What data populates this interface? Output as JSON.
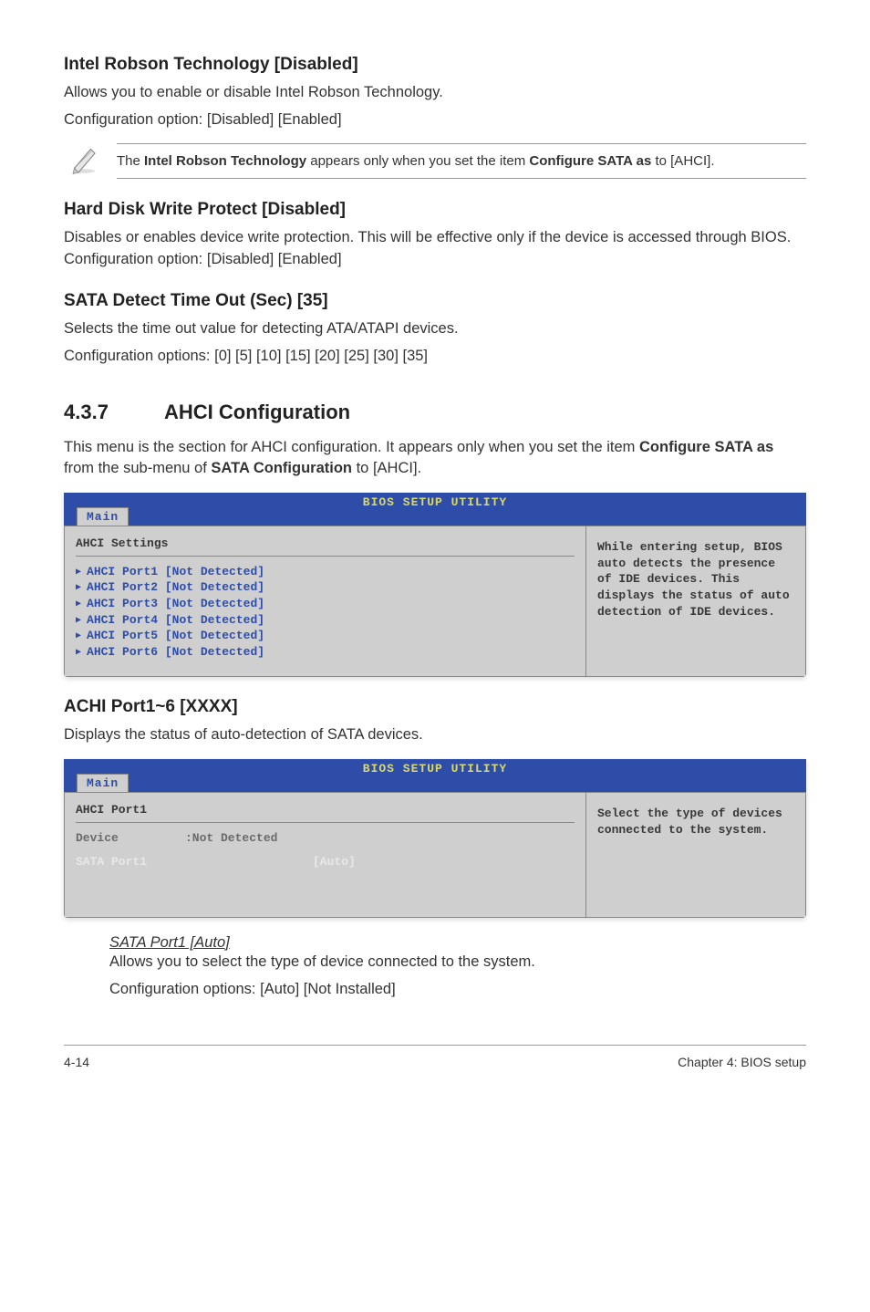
{
  "s1": {
    "heading": "Intel Robson Technology [Disabled]",
    "p1": "Allows you to enable or disable Intel Robson Technology.",
    "p2": "Configuration option: [Disabled] [Enabled]",
    "note_pre": "The ",
    "note_b1": "Intel Robson Technology",
    "note_mid": " appears only when you set the item ",
    "note_b2": "Configure SATA as",
    "note_post": " to [AHCI]."
  },
  "s2": {
    "heading": "Hard Disk Write Protect [Disabled]",
    "p1": "Disables or enables device write protection. This will be effective only if the device is accessed through BIOS. Configuration option: [Disabled] [Enabled]"
  },
  "s3": {
    "heading": "SATA Detect Time Out (Sec) [35]",
    "p1": "Selects the time out value for detecting ATA/ATAPI devices.",
    "p2": "Configuration options: [0] [5] [10] [15] [20] [25] [30] [35]"
  },
  "s4": {
    "num": "4.3.7",
    "title": "AHCI Configuration",
    "p1_pre": "This menu is the section for AHCI configuration. It appears only when you set the item ",
    "p1_b1": "Configure SATA as",
    "p1_mid": " from the sub-menu of ",
    "p1_b2": "SATA Configuration",
    "p1_post": " to [AHCI]."
  },
  "bios1": {
    "title": "BIOS SETUP UTILITY",
    "tab": "Main",
    "panel_title": "AHCI Settings",
    "rows": [
      "AHCI Port1 [Not Detected]",
      "AHCI Port2 [Not Detected]",
      "AHCI Port3 [Not Detected]",
      "AHCI Port4 [Not Detected]",
      "AHCI Port5 [Not Detected]",
      "AHCI Port6 [Not Detected]"
    ],
    "help": "While entering setup, BIOS auto detects the presence of IDE devices. This displays the status of auto detection of IDE devices."
  },
  "s5": {
    "heading": "ACHI Port1~6 [XXXX]",
    "p1": "Displays the status of auto-detection of SATA devices."
  },
  "bios2": {
    "title": "BIOS SETUP UTILITY",
    "tab": "Main",
    "panel_title": "AHCI Port1",
    "device_label": "Device",
    "device_value": ":Not Detected",
    "opt_label": "SATA Port1",
    "opt_value": "[Auto]",
    "help": "Select the type of devices connected to the system."
  },
  "s6": {
    "sub": "SATA Port1 [Auto]",
    "p1": "Allows you to select the type of device connected to the system.",
    "p2": "Configuration options: [Auto] [Not Installed]"
  },
  "footer": {
    "left": "4-14",
    "right": "Chapter 4: BIOS setup"
  }
}
